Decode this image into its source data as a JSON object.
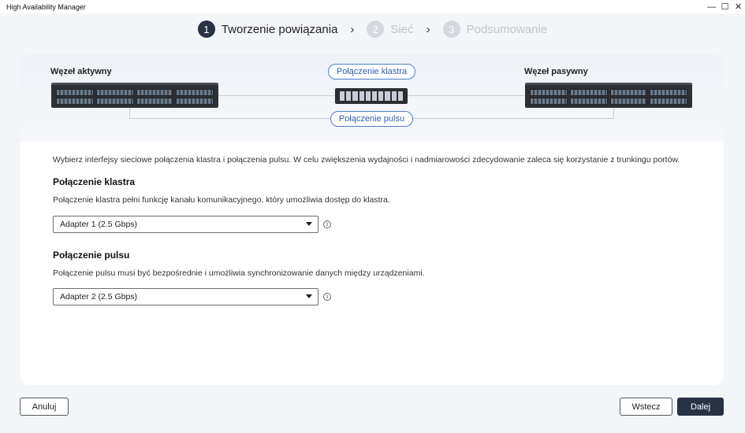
{
  "window": {
    "title": "High Availability Manager",
    "controls": {
      "minimize": "—",
      "maximize": "☐",
      "close": "✕"
    }
  },
  "stepper": {
    "steps": [
      {
        "number": "1",
        "label": "Tworzenie powiązania",
        "state": "active"
      },
      {
        "number": "2",
        "label": "Sieć",
        "state": "inactive"
      },
      {
        "number": "3",
        "label": "Podsumowanie",
        "state": "inactive"
      }
    ],
    "separator": "›"
  },
  "diagram": {
    "active_node_label": "Węzeł aktywny",
    "passive_node_label": "Węzeł pasywny",
    "cluster_connection_label": "Połączenie klastra",
    "heartbeat_connection_label": "Połączenie pulsu"
  },
  "content": {
    "intro": "Wybierz interfejsy sieciowe połączenia klastra i połączenia pulsu. W celu zwiększenia wydajności i nadmiarowości zdecydowanie zaleca się korzystanie z trunkingu portów.",
    "cluster": {
      "title": "Połączenie klastra",
      "description": "Połączenie klastra pełni funkcję kanału komunikacyjnego, który umożliwia dostęp do klastra.",
      "selected": "Adapter 1  (2.5 Gbps)"
    },
    "heartbeat": {
      "title": "Połączenie pulsu",
      "description": "Połączenie pulsu musi być bezpośrednie i umożliwia synchronizowanie danych między urządzeniami.",
      "selected": "Adapter 2  (2.5 Gbps)"
    },
    "info_glyph": "i"
  },
  "footer": {
    "cancel_label": "Anuluj",
    "back_label": "Wstecz",
    "next_label": "Dalej"
  },
  "colors": {
    "primary": "#273245",
    "accent_blue": "#2f5fa8",
    "background": "#f3f5f8"
  }
}
